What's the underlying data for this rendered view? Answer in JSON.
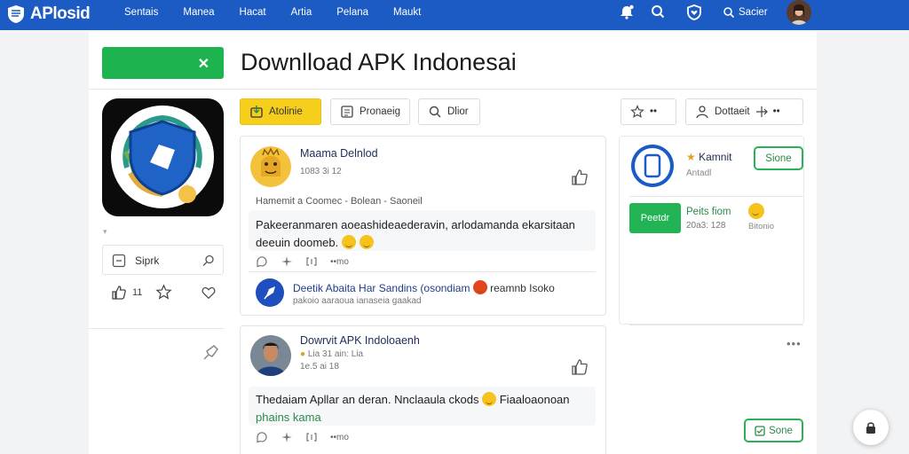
{
  "brand": {
    "logo_text": "APlosid"
  },
  "nav": {
    "items": [
      "Sentais",
      "Manea",
      "Hacat",
      "Artia",
      "Pelana",
      "Maukt"
    ]
  },
  "topbar": {
    "search_label": "Sacier"
  },
  "colors": {
    "topbar": "#1c5bc4",
    "accent_green": "#1db34f",
    "accent_yellow": "#f6cf1d"
  },
  "page": {
    "title": "Downlload APK Indonesai"
  },
  "sidebar": {
    "box_label": "Siprk",
    "like_count": "11"
  },
  "toolbar": {
    "btn1": "Atolinie",
    "btn2": "Pronaeig",
    "btn3": "Dlior",
    "more": "••",
    "btn5": "Dottaeit",
    "more2": "••"
  },
  "posts": [
    {
      "name": "Maama Delnlod",
      "meta": "1083 3i 12",
      "sub": "Hamemit a Coomec - Bolean - Saoneil",
      "body_a": "Pakeeranmaren aoeashideaederavin, arlodamanda ekarsitaan",
      "body_b": "deeuin doomeb.",
      "actions": [
        "••mo"
      ],
      "reply": {
        "text": "Deetik Abaita  Har Sandins (osondiam",
        "text_b": "reamnb Isoko",
        "sub": "pakoio aaraoua ianaseia gaakad"
      }
    },
    {
      "name": "Dowrvit APK Indoloaenh",
      "meta": "Lia 31 ain: Lia",
      "meta2": "1e.5 ai 18",
      "body_a": "Thedaiam Apllar an deran. Nnclaaula ckods",
      "body_b": "Fiaaloaonoan",
      "body_c": "phains kama",
      "actions": [
        "••mo"
      ]
    }
  ],
  "right": {
    "card_title": "Kamnit",
    "card_sub": "Antadl",
    "card_button": "Sione",
    "green_btn": "Peetdr",
    "green_title": "Peits fiom",
    "green_sub": "20a3: 128",
    "emoji_sub": "Bitonio",
    "bottom_btn": "Sone"
  }
}
